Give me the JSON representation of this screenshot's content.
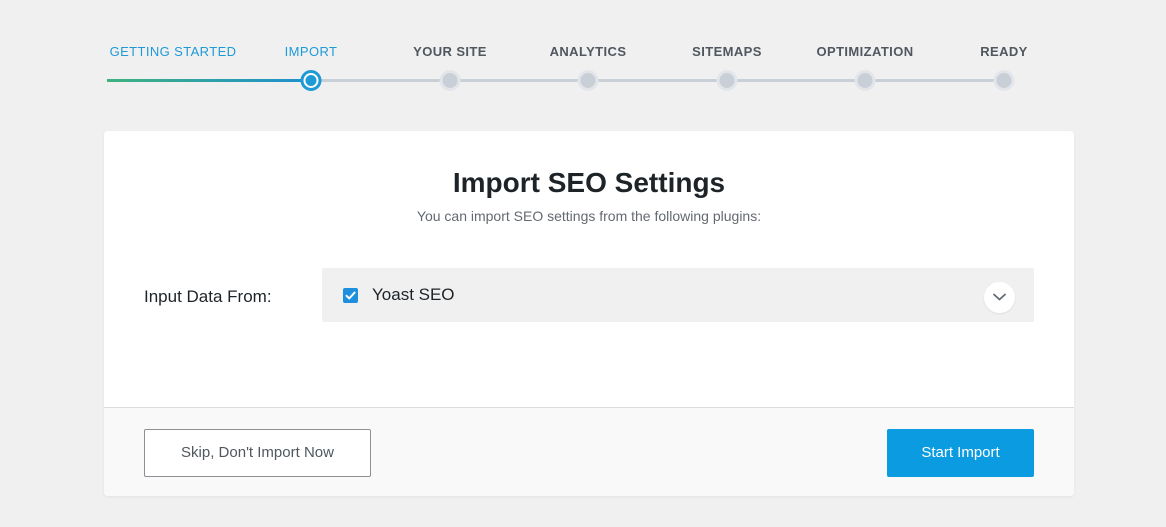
{
  "steps": [
    {
      "label": "GETTING STARTED",
      "state": "done"
    },
    {
      "label": "IMPORT",
      "state": "current"
    },
    {
      "label": "YOUR SITE",
      "state": "pending"
    },
    {
      "label": "ANALYTICS",
      "state": "pending"
    },
    {
      "label": "SITEMAPS",
      "state": "pending"
    },
    {
      "label": "OPTIMIZATION",
      "state": "pending"
    },
    {
      "label": "READY",
      "state": "pending"
    }
  ],
  "colors": {
    "accent": "#1e9ad6",
    "progress_start": "#3fb27f",
    "button_primary": "#0b9be0",
    "inactive": "#c9cfd6"
  },
  "card": {
    "title": "Import SEO Settings",
    "subtitle": "You can import SEO settings from the following plugins:",
    "field_label": "Input Data From:",
    "selected_option": "Yoast SEO",
    "checked": true,
    "dropdown_icon": "chevron-down-icon"
  },
  "footer": {
    "skip_label": "Skip, Don't Import Now",
    "start_label": "Start Import"
  }
}
